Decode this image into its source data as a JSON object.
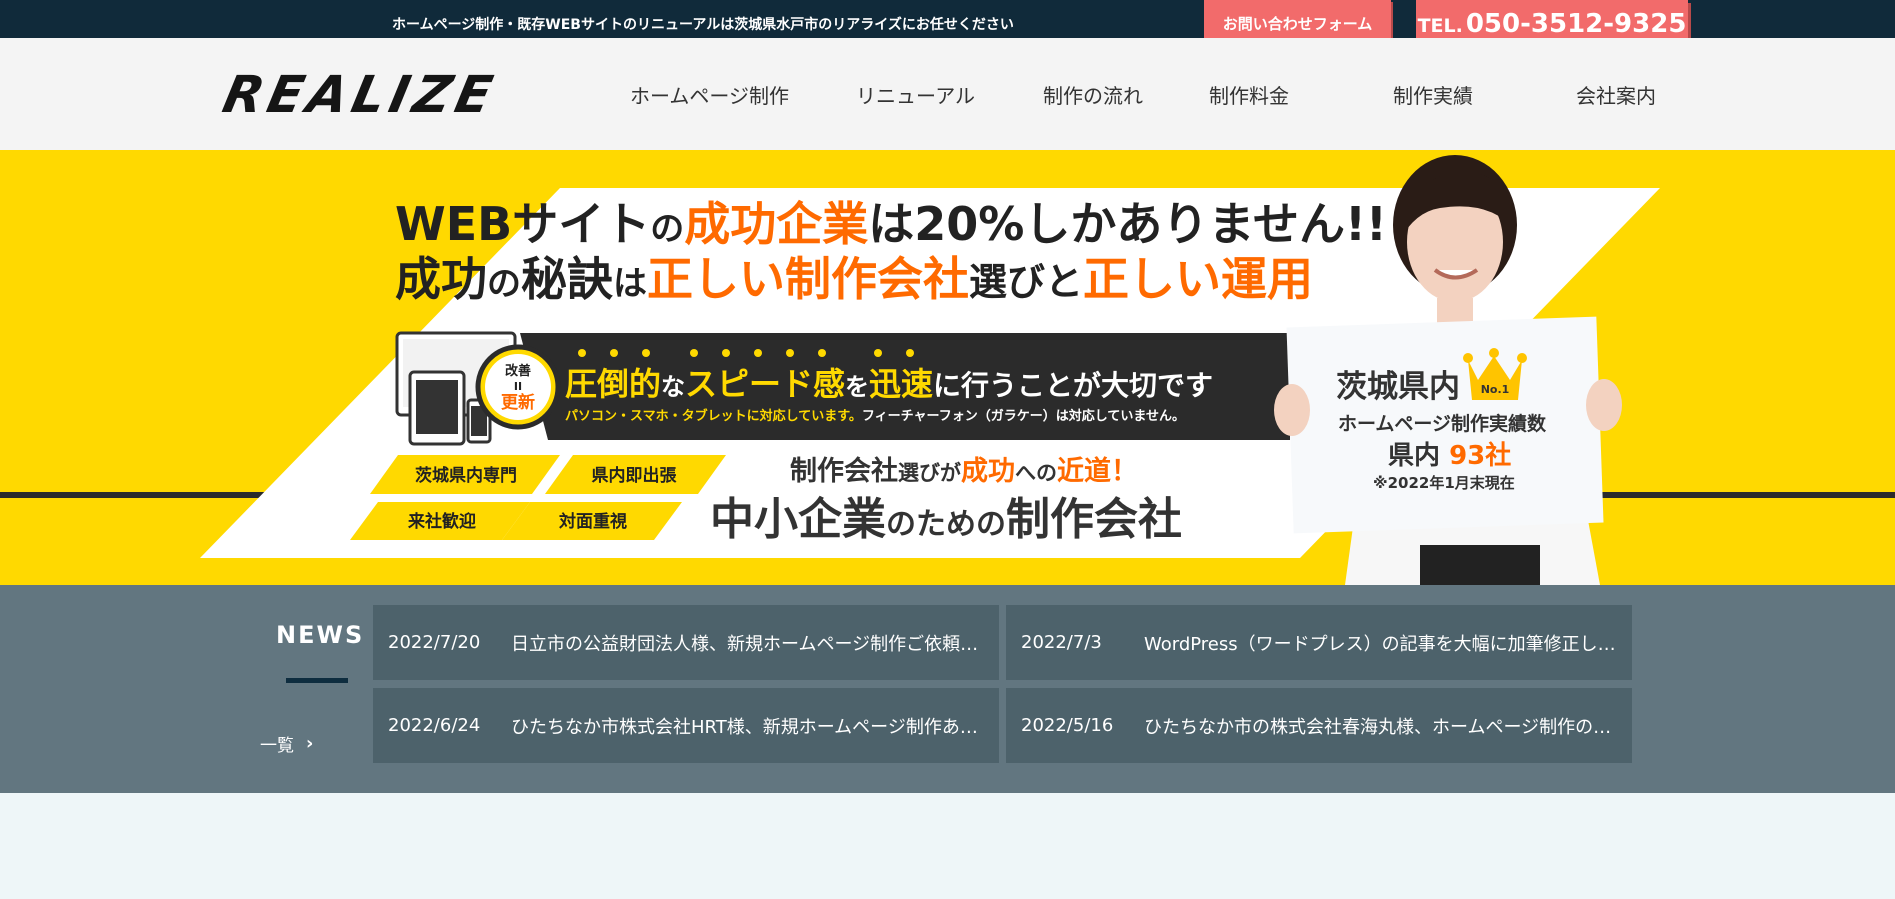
{
  "topbar": {
    "tagline": "ホームページ制作・既存WEBサイトのリニューアルは茨城県水戸市のリアライズにお任せください",
    "contact_label": "お問い合わせフォーム",
    "tel_prefix": "TEL.",
    "tel_number": "050-3512-9325"
  },
  "header": {
    "logo": "REALIZE",
    "nav": [
      {
        "label": "ホームページ制作"
      },
      {
        "label": "リニューアル"
      },
      {
        "label": "制作の流れ"
      },
      {
        "label": "制作料金"
      },
      {
        "label": "制作実績"
      },
      {
        "label": "会社案内"
      }
    ]
  },
  "hero": {
    "headline1_a": "WEBサイト",
    "headline1_b": "の",
    "headline1_c": "成功企業",
    "headline1_d": "は20%しかありません!!",
    "headline2_a": "成功",
    "headline2_b": "の",
    "headline2_c": "秘訣",
    "headline2_d": "は",
    "headline2_e": "正しい制作会社",
    "headline2_f": "選びと",
    "headline2_g": "正しい運用",
    "badge_top": "改善",
    "badge_mid": "II",
    "badge_bottom": "更新",
    "band_a": "圧倒的",
    "band_b": "な",
    "band_c": "スピード感",
    "band_d": "を",
    "band_e": "迅速",
    "band_f": "に行うことが大切です",
    "band_sub1": "パソコン・スマホ・タブレットに対応しています。",
    "band_sub2": "フィーチャーフォン（ガラケー）は対応していません。",
    "tags": [
      "茨城県内専門",
      "県内即出張",
      "来社歓迎",
      "対面重視"
    ],
    "tagline_a": "制作会社",
    "tagline_b": "選びが",
    "tagline_c": "成功",
    "tagline_d": "への",
    "tagline_e": "近道！",
    "main_a": "中小企業",
    "main_b": "のための",
    "main_c": "制作会社",
    "board_line1": "茨城県内",
    "board_crown": "No.1",
    "board_line2": "ホームページ制作実績数",
    "board_line3_a": "県内 ",
    "board_line3_b": "93社",
    "board_line4": "※2022年1月末現在"
  },
  "news": {
    "title": "NEWS",
    "more_label": "一覧",
    "items": [
      {
        "date": "2022/7/20",
        "text": "日立市の公益財団法人様、新規ホームページ制作ご依頼ありがとうございます"
      },
      {
        "date": "2022/7/3",
        "text": "WordPress（ワードプレス）の記事を大幅に加筆修正しました"
      },
      {
        "date": "2022/6/24",
        "text": "ひたちなか市株式会社HRT様、新規ホームページ制作ありがとうございます"
      },
      {
        "date": "2022/5/16",
        "text": "ひたちなか市の株式会社春海丸様、ホームページ制作のご依頼ありがとうございます"
      }
    ]
  },
  "colors": {
    "topbar_bg": "#102a3a",
    "accent_red": "#f26b6b",
    "hero_yellow": "#ffd900",
    "hero_orange": "#ff6a00",
    "news_bg": "#627680",
    "news_card": "#4d626b"
  }
}
